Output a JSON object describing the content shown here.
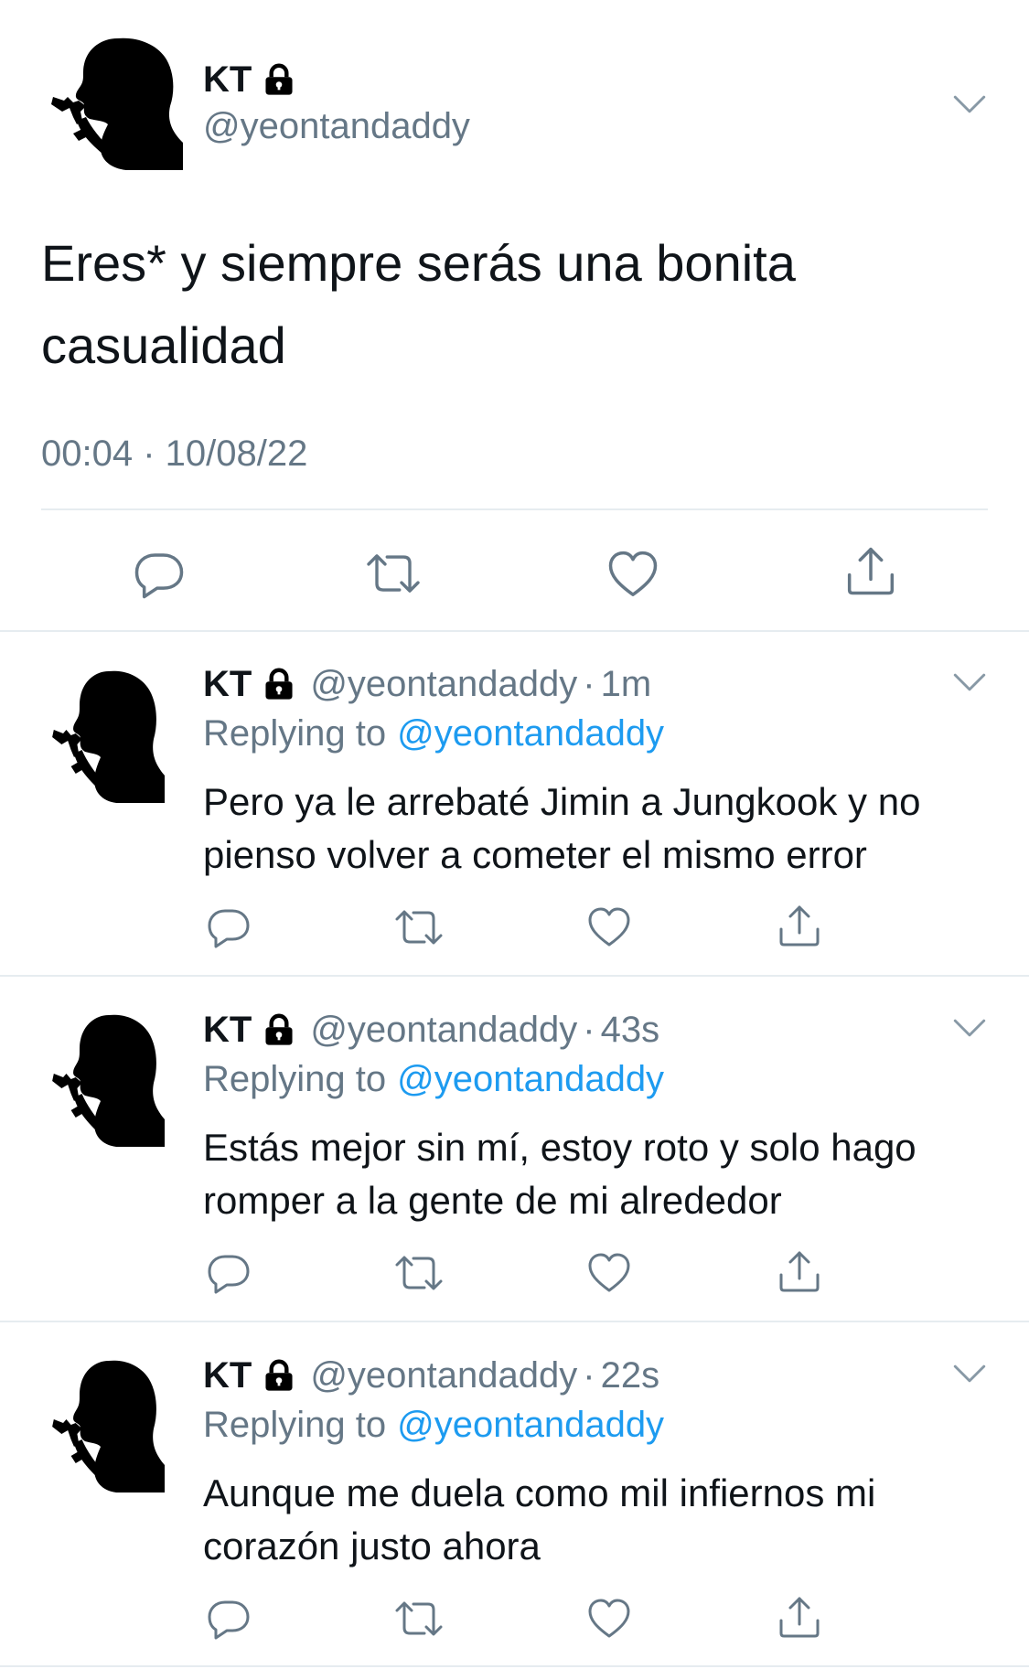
{
  "main_tweet": {
    "display_name": "KT",
    "handle": "@yeontandaddy",
    "text_line1": "Eres* y siempre serás una bonita",
    "text_line2": "casualidad",
    "timestamp": "00:04 · 10/08/22"
  },
  "replies": [
    {
      "display_name": "KT",
      "handle": "@yeontandaddy",
      "sep": "·",
      "time": "1m",
      "replying_prefix": "Replying to",
      "replying_handle": "@yeontandaddy",
      "text_line1": "Pero ya le arrebaté Jimin a Jungkook y no",
      "text_line2": "pienso volver a cometer el mismo error"
    },
    {
      "display_name": "KT",
      "handle": "@yeontandaddy",
      "sep": "·",
      "time": "43s",
      "replying_prefix": "Replying to",
      "replying_handle": "@yeontandaddy",
      "text_line1": "Estás mejor sin mí, estoy roto y solo hago",
      "text_line2": "romper a la gente de mi alrededor"
    },
    {
      "display_name": "KT",
      "handle": "@yeontandaddy",
      "sep": "·",
      "time": "22s",
      "replying_prefix": "Replying to",
      "replying_handle": "@yeontandaddy",
      "text_line1": "Aunque me duela como mil infiernos mi",
      "text_line2": "corazón justo ahora"
    }
  ],
  "icons": {
    "lock": "lock-icon",
    "chevron": "chevron-down-icon",
    "reply": "reply-icon",
    "retweet": "retweet-icon",
    "like": "heart-icon",
    "share": "share-icon"
  },
  "colors": {
    "text": "#0f1419",
    "secondary": "#657786",
    "link": "#1d9bf0",
    "divider": "#e6ecf0"
  }
}
